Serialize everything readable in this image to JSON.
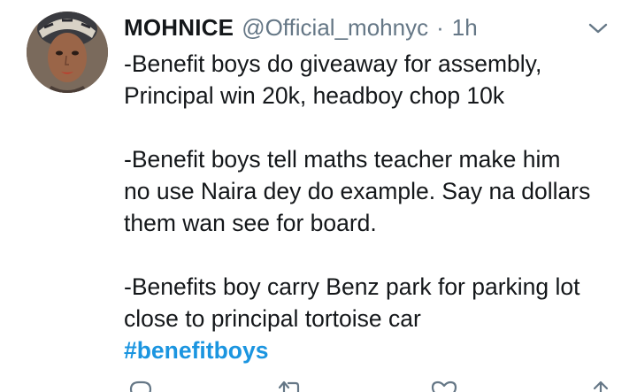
{
  "tweet": {
    "display_name": "MOHNICE",
    "handle": "@Official_mohnyc",
    "separator": "·",
    "time": "1h",
    "lines": {
      "p1a": "-Benefit boys do giveaway for assembly,",
      "p1b": "Principal win 20k, headboy chop 10k",
      "p2a": "-Benefit boys tell maths teacher make him",
      "p2b": "no use Naira dey do example. Say na dollars",
      "p2c": "them wan see for board.",
      "p3a": "-Benefits boy carry Benz park for parking lot",
      "p3b": "close to principal tortoise car"
    },
    "hashtag": "#benefitboys"
  },
  "icons": {
    "menu": "chevron-down-icon",
    "reply": "reply-icon",
    "retweet": "retweet-icon",
    "like": "heart-icon",
    "share": "share-icon"
  },
  "colors": {
    "text": "#14171a",
    "secondary": "#657786",
    "link": "#1b95e0"
  }
}
